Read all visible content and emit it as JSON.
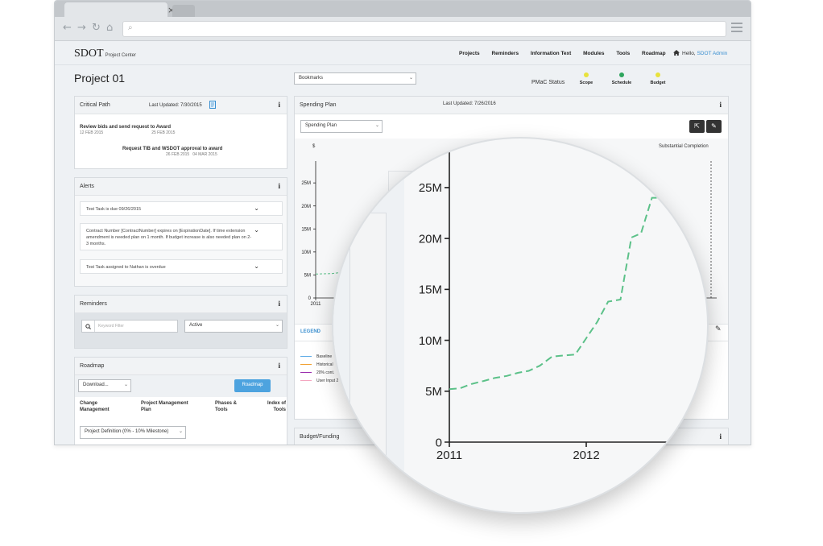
{
  "browser": {
    "tab_close": "×",
    "search_icon": "⌕",
    "nav": {
      "back": "←",
      "forward": "→",
      "reload": "↻",
      "home": "⌂"
    }
  },
  "app": {
    "logo": "SDOT",
    "logo_sub": "Project Center",
    "nav": [
      "Projects",
      "Reminders",
      "Information Text",
      "Modules",
      "Tools",
      "Roadmap"
    ],
    "hello_prefix": "Hello,",
    "user": "SDOT Admin"
  },
  "page": {
    "title": "Project 01"
  },
  "bookmarks": {
    "label": "Bookmarks"
  },
  "pmac": {
    "label": "PMaC Status",
    "items": [
      {
        "label": "Scope",
        "color": "#e8e23c"
      },
      {
        "label": "Schedule",
        "color": "#2ea55d"
      },
      {
        "label": "Budget",
        "color": "#e8e23c"
      }
    ]
  },
  "critical_path": {
    "title": "Critical Path",
    "updated": "Last Updated: 7/30/2015",
    "tasks": [
      {
        "name": "Review bids and send request to Award",
        "start": "12 FEB 2015",
        "end": "25 FEB 2015"
      },
      {
        "name": "Request TIB and WSDOT approval to award",
        "start": "26 FEB 2015",
        "end": "04 MAR 2015"
      }
    ]
  },
  "alerts": {
    "title": "Alerts",
    "items": [
      "Test Task is due 09/26/2015",
      "Contract Number [ContractNumber] expires on [ExpirationDate]. If time extension amendment is needed plan on 1 month. If budget increase is also needed plan on 2-3 months.",
      "Test Task assigned to Nathan is overdue"
    ]
  },
  "reminders": {
    "title": "Reminders",
    "placeholder": "Keyword Filter",
    "filter": "Active"
  },
  "roadmap": {
    "title": "Roadmap",
    "download": "Download...",
    "button": "Roadmap",
    "columns": [
      "Change Management",
      "Project Management Plan",
      "Phases & Tools",
      "Index of Tools"
    ],
    "phase": "Project Definition (0% - 10% Milestone)"
  },
  "spending_plan": {
    "title": "Spending Plan",
    "updated": "Last Updated: 7/26/2016",
    "select": "Spending Plan",
    "currency": "$",
    "marker": "Substantial Completion",
    "legend_title": "LEGEND",
    "legend": [
      {
        "label": "Baseline",
        "color": "#5aa9e6"
      },
      {
        "label": "Historical",
        "color": "#f0a030"
      },
      {
        "label": "20% cont.",
        "color": "#9b2fae"
      },
      {
        "label": "User Input 2",
        "color": "#f4a6c0"
      }
    ]
  },
  "budget": {
    "title": "Budget/Funding"
  },
  "chart_data": {
    "type": "line",
    "series": [
      {
        "color": "#5cc189",
        "x": [
          2011.0,
          2011.08,
          2011.16,
          2011.25,
          2011.33,
          2011.42,
          2011.5,
          2011.58,
          2011.66,
          2011.75,
          2011.83,
          2011.92,
          2012.0,
          2012.08,
          2012.16,
          2012.25,
          2012.33,
          2012.4,
          2012.48,
          2012.58
        ],
        "values": [
          5.2,
          5.3,
          5.7,
          6.0,
          6.3,
          6.5,
          6.8,
          7.0,
          7.5,
          8.4,
          8.5,
          8.6,
          10.2,
          11.8,
          13.8,
          14.0,
          20.1,
          20.5,
          24.0,
          24.0
        ]
      }
    ],
    "yticks": [
      "0",
      "5M",
      "10M",
      "15M",
      "20M",
      "25M"
    ],
    "ylim": [
      0,
      28
    ],
    "xticks": [
      "2011",
      "2012"
    ],
    "grid": false,
    "line_style": "dashed"
  }
}
